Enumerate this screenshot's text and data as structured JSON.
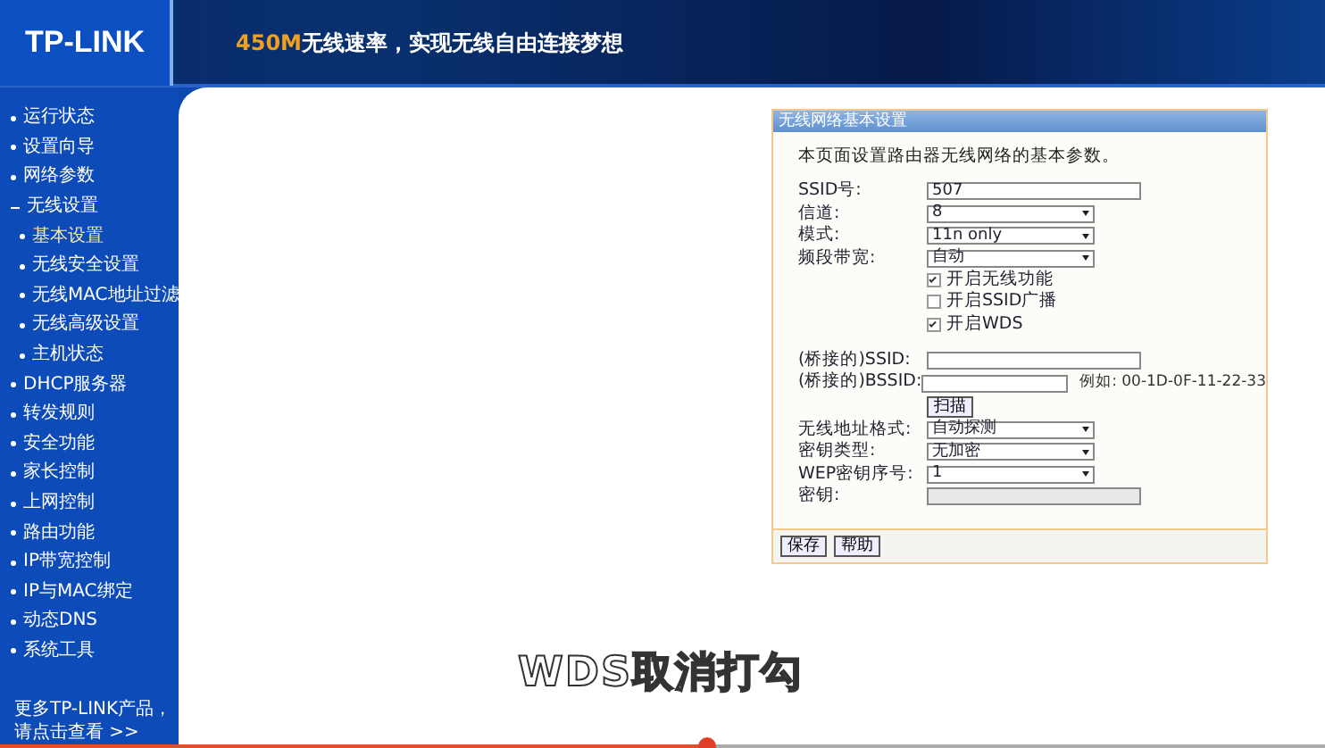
{
  "header": {
    "logo": "TP-LINK",
    "slogan_highlight": "450M",
    "slogan": "无线速率，实现无线自由连接梦想"
  },
  "sidebar": {
    "items": [
      {
        "label": "运行状态",
        "expanded": false
      },
      {
        "label": "设置向导",
        "expanded": false
      },
      {
        "label": "网络参数",
        "expanded": false
      },
      {
        "label": "无线设置",
        "expanded": true,
        "children": [
          {
            "label": "基本设置",
            "selected": true
          },
          {
            "label": "无线安全设置",
            "selected": false
          },
          {
            "label": "无线MAC地址过滤",
            "selected": false
          },
          {
            "label": "无线高级设置",
            "selected": false
          },
          {
            "label": "主机状态",
            "selected": false
          }
        ]
      },
      {
        "label": "DHCP服务器",
        "expanded": false
      },
      {
        "label": "转发规则",
        "expanded": false
      },
      {
        "label": "安全功能",
        "expanded": false
      },
      {
        "label": "家长控制",
        "expanded": false
      },
      {
        "label": "上网控制",
        "expanded": false
      },
      {
        "label": "路由功能",
        "expanded": false
      },
      {
        "label": "IP带宽控制",
        "expanded": false
      },
      {
        "label": "IP与MAC绑定",
        "expanded": false
      },
      {
        "label": "动态DNS",
        "expanded": false
      },
      {
        "label": "系统工具",
        "expanded": false
      }
    ],
    "footer": [
      "更多TP-LINK产品，",
      "请点击查看 >>"
    ]
  },
  "panel": {
    "title": "无线网络基本设置",
    "description": "本页面设置路由器无线网络的基本参数。",
    "rows": [
      {
        "kind": "text",
        "label": "SSID号:",
        "value": "507"
      },
      {
        "kind": "select",
        "label": "信道:",
        "value": "8"
      },
      {
        "kind": "select",
        "label": "模式:",
        "value": "11n only"
      },
      {
        "kind": "select",
        "label": "频段带宽:",
        "value": "自动"
      },
      {
        "kind": "checkbox",
        "label": "开启无线功能",
        "checked": true
      },
      {
        "kind": "checkbox",
        "label": "开启SSID广播",
        "checked": false
      },
      {
        "kind": "checkbox",
        "label": "开启WDS",
        "checked": true
      },
      {
        "kind": "gap"
      },
      {
        "kind": "text",
        "label": "(桥接的)SSID:",
        "value": ""
      },
      {
        "kind": "text",
        "label": "(桥接的)BSSID:",
        "value": "",
        "hint": "例如: 00-1D-0F-11-22-33"
      },
      {
        "kind": "button",
        "label": "扫描"
      },
      {
        "kind": "select",
        "label": "无线地址格式:",
        "value": "自动探测"
      },
      {
        "kind": "select",
        "label": "密钥类型:",
        "value": "无加密"
      },
      {
        "kind": "select",
        "label": "WEP密钥序号:",
        "value": "1"
      },
      {
        "kind": "text",
        "label": "密钥:",
        "value": "",
        "disabled": true
      }
    ],
    "buttons": [
      "保存",
      "帮助"
    ]
  },
  "subtitle": "WDS取消打勾",
  "video": {
    "level": 0.534
  }
}
